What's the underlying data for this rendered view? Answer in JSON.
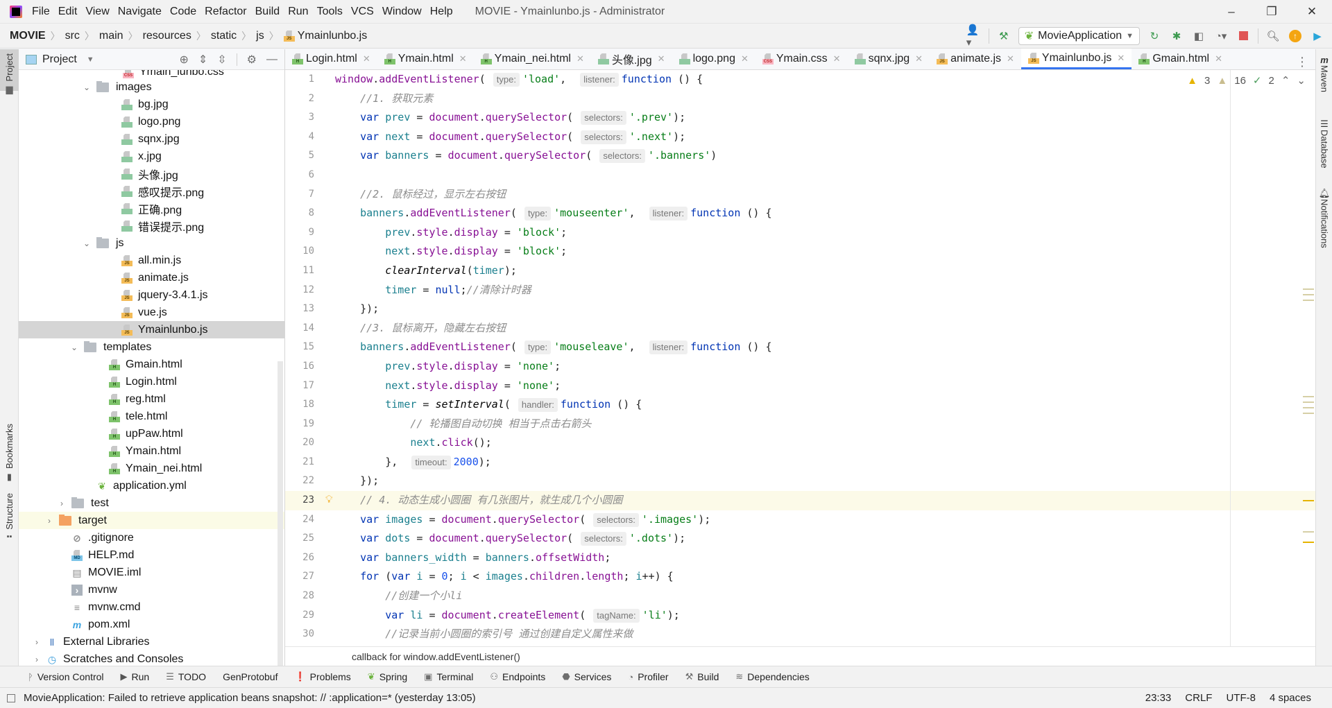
{
  "menu": {
    "items": [
      "File",
      "Edit",
      "View",
      "Navigate",
      "Code",
      "Refactor",
      "Build",
      "Run",
      "Tools",
      "VCS",
      "Window",
      "Help"
    ],
    "window_title": "MOVIE - Ymainlunbo.js - Administrator"
  },
  "window_controls": {
    "minimize": "–",
    "restore": "❐",
    "close": "✕"
  },
  "breadcrumb": {
    "items": [
      "MOVIE",
      "src",
      "main",
      "resources",
      "static",
      "js",
      "Ymainlunbo.js"
    ]
  },
  "toolbar": {
    "run_config": "MovieApplication"
  },
  "project_panel": {
    "title": "Project",
    "tree": [
      {
        "label": "Ymain_lunbo.css",
        "icon": "css",
        "depth": 7,
        "partial": true
      },
      {
        "label": "images",
        "icon": "folder",
        "depth": 5,
        "expanded": true
      },
      {
        "label": "bg.jpg",
        "icon": "img",
        "depth": 7
      },
      {
        "label": "logo.png",
        "icon": "img",
        "depth": 7
      },
      {
        "label": "sqnx.jpg",
        "icon": "img",
        "depth": 7
      },
      {
        "label": "x.jpg",
        "icon": "img",
        "depth": 7
      },
      {
        "label": "头像.jpg",
        "icon": "img",
        "depth": 7
      },
      {
        "label": "感叹提示.png",
        "icon": "img",
        "depth": 7
      },
      {
        "label": "正确.png",
        "icon": "img",
        "depth": 7
      },
      {
        "label": "错误提示.png",
        "icon": "img",
        "depth": 7
      },
      {
        "label": "js",
        "icon": "folder",
        "depth": 5,
        "expanded": true
      },
      {
        "label": "all.min.js",
        "icon": "js",
        "depth": 7
      },
      {
        "label": "animate.js",
        "icon": "js",
        "depth": 7
      },
      {
        "label": "jquery-3.4.1.js",
        "icon": "js",
        "depth": 7
      },
      {
        "label": "vue.js",
        "icon": "js",
        "depth": 7
      },
      {
        "label": "Ymainlunbo.js",
        "icon": "js",
        "depth": 7,
        "selected": true
      },
      {
        "label": "templates",
        "icon": "folder",
        "depth": 4,
        "expanded": true
      },
      {
        "label": "Gmain.html",
        "icon": "h",
        "depth": 6
      },
      {
        "label": "Login.html",
        "icon": "h",
        "depth": 6
      },
      {
        "label": "reg.html",
        "icon": "h",
        "depth": 6
      },
      {
        "label": "tele.html",
        "icon": "h",
        "depth": 6
      },
      {
        "label": "upPaw.html",
        "icon": "h",
        "depth": 6
      },
      {
        "label": "Ymain.html",
        "icon": "h",
        "depth": 6
      },
      {
        "label": "Ymain_nei.html",
        "icon": "h",
        "depth": 6
      },
      {
        "label": "application.yml",
        "icon": "yml",
        "depth": 5
      },
      {
        "label": "test",
        "icon": "folder",
        "depth": 3,
        "expanded": false
      },
      {
        "label": "target",
        "icon": "folder-orange",
        "depth": 2,
        "expanded": false,
        "highlight": true
      },
      {
        "label": ".gitignore",
        "icon": "ignore",
        "depth": 3
      },
      {
        "label": "HELP.md",
        "icon": "md",
        "depth": 3
      },
      {
        "label": "MOVIE.iml",
        "icon": "iml",
        "depth": 3
      },
      {
        "label": "mvnw",
        "icon": "shell",
        "depth": 3
      },
      {
        "label": "mvnw.cmd",
        "icon": "text",
        "depth": 3
      },
      {
        "label": "pom.xml",
        "icon": "maven",
        "depth": 3
      },
      {
        "label": "External Libraries",
        "icon": "libs",
        "depth": 1,
        "expanded": false
      },
      {
        "label": "Scratches and Consoles",
        "icon": "scratch",
        "depth": 1,
        "expanded": false
      }
    ]
  },
  "left_strip": {
    "project": "Project",
    "bookmarks": "Bookmarks",
    "structure": "Structure"
  },
  "right_strip": {
    "maven": "Maven",
    "database": "Database",
    "notifications": "Notifications"
  },
  "tabs": [
    {
      "label": "Login.html",
      "icon": "h"
    },
    {
      "label": "Ymain.html",
      "icon": "h"
    },
    {
      "label": "Ymain_nei.html",
      "icon": "h"
    },
    {
      "label": "头像.jpg",
      "icon": "img"
    },
    {
      "label": "logo.png",
      "icon": "img"
    },
    {
      "label": "Ymain.css",
      "icon": "css"
    },
    {
      "label": "sqnx.jpg",
      "icon": "img"
    },
    {
      "label": "animate.js",
      "icon": "js"
    },
    {
      "label": "Ymainlunbo.js",
      "icon": "js",
      "active": true
    },
    {
      "label": "Gmain.html",
      "icon": "h"
    }
  ],
  "inspections": {
    "warnings": "3",
    "weak_warnings": "16",
    "typos": "2"
  },
  "code_lines": [
    "<span class=\"fn\">window</span>.<span class=\"fn\">addEventListener</span>( <span class=\"hint\">type:</span><span class=\"str\">'load'</span>,  <span class=\"hint\">listener:</span><span class=\"kw\">function</span> () {",
    "    <span class=\"cm\">//1. 获取元素</span>",
    "    <span class=\"kw\">var</span> <span class=\"var\">prev</span> = <span class=\"fn\">document</span>.<span class=\"fn\">querySelector</span>( <span class=\"hint\">selectors:</span><span class=\"str\">'.prev'</span>);",
    "    <span class=\"kw\">var</span> <span class=\"var\">next</span> = <span class=\"fn\">document</span>.<span class=\"fn\">querySelector</span>( <span class=\"hint\">selectors:</span><span class=\"str\">'.next'</span>);",
    "    <span class=\"kw\">var</span> <span class=\"var\">banners</span> = <span class=\"fn\">document</span>.<span class=\"fn\">querySelector</span>( <span class=\"hint\">selectors:</span><span class=\"str\">'.banners'</span>)",
    "",
    "    <span class=\"cm\">//2. 鼠标经过，显示左右按钮</span>",
    "    <span class=\"var\">banners</span>.<span class=\"fn\">addEventListener</span>( <span class=\"hint\">type:</span><span class=\"str\">'mouseenter'</span>,  <span class=\"hint\">listener:</span><span class=\"kw\">function</span> () {",
    "        <span class=\"var\">prev</span>.<span class=\"fn\">style</span>.<span class=\"fn\">display</span> = <span class=\"str\">'block'</span>;",
    "        <span class=\"var\">next</span>.<span class=\"fn\">style</span>.<span class=\"fn\">display</span> = <span class=\"str\">'block'</span>;",
    "        <span class=\"it\">clearInterval</span>(<span class=\"var\">timer</span>);",
    "        <span class=\"var\">timer</span> = <span class=\"kw\">null</span>;<span class=\"cm\">//清除计时器</span>",
    "    });",
    "    <span class=\"cm\">//3. 鼠标离开，隐藏左右按钮</span>",
    "    <span class=\"var\">banners</span>.<span class=\"fn\">addEventListener</span>( <span class=\"hint\">type:</span><span class=\"str\">'mouseleave'</span>,  <span class=\"hint\">listener:</span><span class=\"kw\">function</span> () {",
    "        <span class=\"var\">prev</span>.<span class=\"fn\">style</span>.<span class=\"fn\">display</span> = <span class=\"str\">'none'</span>;",
    "        <span class=\"var\">next</span>.<span class=\"fn\">style</span>.<span class=\"fn\">display</span> = <span class=\"str\">'none'</span>;",
    "        <span class=\"var\">timer</span> = <span class=\"it\">setInterval</span>( <span class=\"hint\">handler:</span><span class=\"kw\">function</span> () {",
    "            <span class=\"cm\">// 轮播图自动切换 相当于点击右箭头</span>",
    "            <span class=\"var\">next</span>.<span class=\"fn\">click</span>();",
    "        },  <span class=\"hint\">timeout:</span><span class=\"num\">2000</span>);",
    "    });",
    "    <span class=\"cm\">// 4. 动态生成小圆圈 有几张图片，就生成几个小圆圈</span>",
    "    <span class=\"kw\">var</span> <span class=\"var\">images</span> = <span class=\"fn\">document</span>.<span class=\"fn\">querySelector</span>( <span class=\"hint\">selectors:</span><span class=\"str\">'.images'</span>);",
    "    <span class=\"kw\">var</span> <span class=\"var\">dots</span> = <span class=\"fn\">document</span>.<span class=\"fn\">querySelector</span>( <span class=\"hint\">selectors:</span><span class=\"str\">'.dots'</span>);",
    "    <span class=\"kw\">var</span> <span class=\"var\">banners_width</span> = <span class=\"var\">banners</span>.<span class=\"fn\">offsetWidth</span>;",
    "    <span class=\"kw\">for</span> (<span class=\"kw\">var</span> <span class=\"var\">i</span> = <span class=\"num\">0</span>; <span class=\"var\">i</span> &lt; <span class=\"var\">images</span>.<span class=\"fn\">children</span>.<span class=\"fn\">length</span>; <span class=\"var\">i</span>++) {",
    "        <span class=\"cm\">//创建一个小li</span>",
    "        <span class=\"kw\">var</span> <span class=\"var\">li</span> = <span class=\"fn\">document</span>.<span class=\"fn\">createElement</span>( <span class=\"hint\">tagName:</span><span class=\"str\">'li'</span>);",
    "        <span class=\"cm\">//记录当前小圆圈的索引号 通过创建自定义属性来做</span>"
  ],
  "current_line": 23,
  "editor_breadcrumb": "callback for window.addEventListener()",
  "tool_windows": [
    {
      "label": "Version Control",
      "icon": "vcs-icon",
      "glyph": "ᚹ"
    },
    {
      "label": "Run",
      "icon": "run-icon",
      "glyph": "▶"
    },
    {
      "label": "TODO",
      "icon": "todo-icon",
      "glyph": "☰"
    },
    {
      "label": "GenProtobuf",
      "icon": "",
      "glyph": ""
    },
    {
      "label": "Problems",
      "icon": "problems-icon",
      "glyph": "❗"
    },
    {
      "label": "Spring",
      "icon": "spring-icon",
      "glyph": "❦"
    },
    {
      "label": "Terminal",
      "icon": "terminal-icon",
      "glyph": "▣"
    },
    {
      "label": "Endpoints",
      "icon": "endpoints-icon",
      "glyph": "⚇"
    },
    {
      "label": "Services",
      "icon": "services-icon",
      "glyph": "⬣"
    },
    {
      "label": "Profiler",
      "icon": "profiler-icon",
      "glyph": "◔"
    },
    {
      "label": "Build",
      "icon": "build-icon",
      "glyph": "⚒"
    },
    {
      "label": "Dependencies",
      "icon": "dependencies-icon",
      "glyph": "≋"
    }
  ],
  "status": {
    "message": "MovieApplication: Failed to retrieve application beans snapshot: // :application=* (yesterday 13:05)",
    "position": "23:33",
    "line_sep": "CRLF",
    "encoding": "UTF-8",
    "indent": "4 spaces"
  }
}
